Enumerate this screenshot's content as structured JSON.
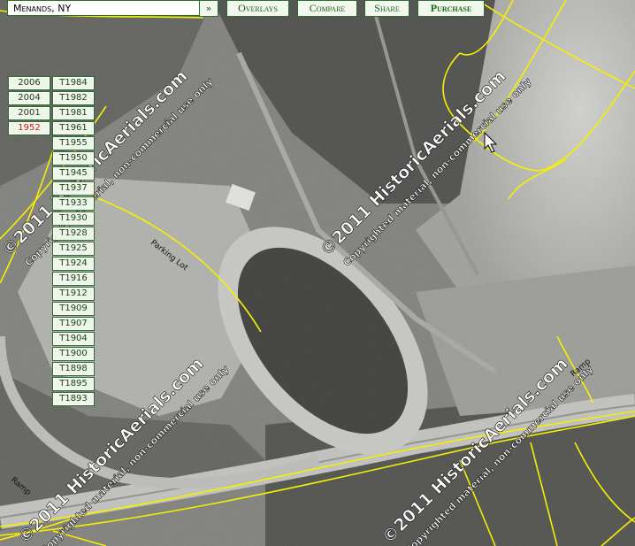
{
  "location": {
    "value": "Menands, NY"
  },
  "go_label": "»",
  "toolbar": {
    "overlays": "Overlays",
    "compare": "Compare",
    "share": "Share",
    "purchase": "Purchase"
  },
  "years_left": [
    "2006",
    "2004",
    "2001",
    "1952"
  ],
  "selected_year": "1952",
  "years_right": [
    "T1984",
    "T1982",
    "T1981",
    "T1961",
    "T1955",
    "T1950",
    "T1945",
    "T1937",
    "T1933",
    "T1930",
    "T1928",
    "T1925",
    "T1924",
    "T1916",
    "T1912",
    "T1909",
    "T1907",
    "T1904",
    "T1900",
    "T1898",
    "T1895",
    "T1893"
  ],
  "map_labels": {
    "parking_lot": "Parking Lot",
    "ramp_left": "Ramp",
    "ramp_right": "Ramp"
  },
  "watermark": {
    "line1": "©2011 HistoricAerials.com",
    "line2": "Copyrighted material, non-commercial use only"
  },
  "colors": {
    "road": "#f5f000",
    "button_border": "#2e6b2e",
    "selected_year": "#c41e1e"
  }
}
